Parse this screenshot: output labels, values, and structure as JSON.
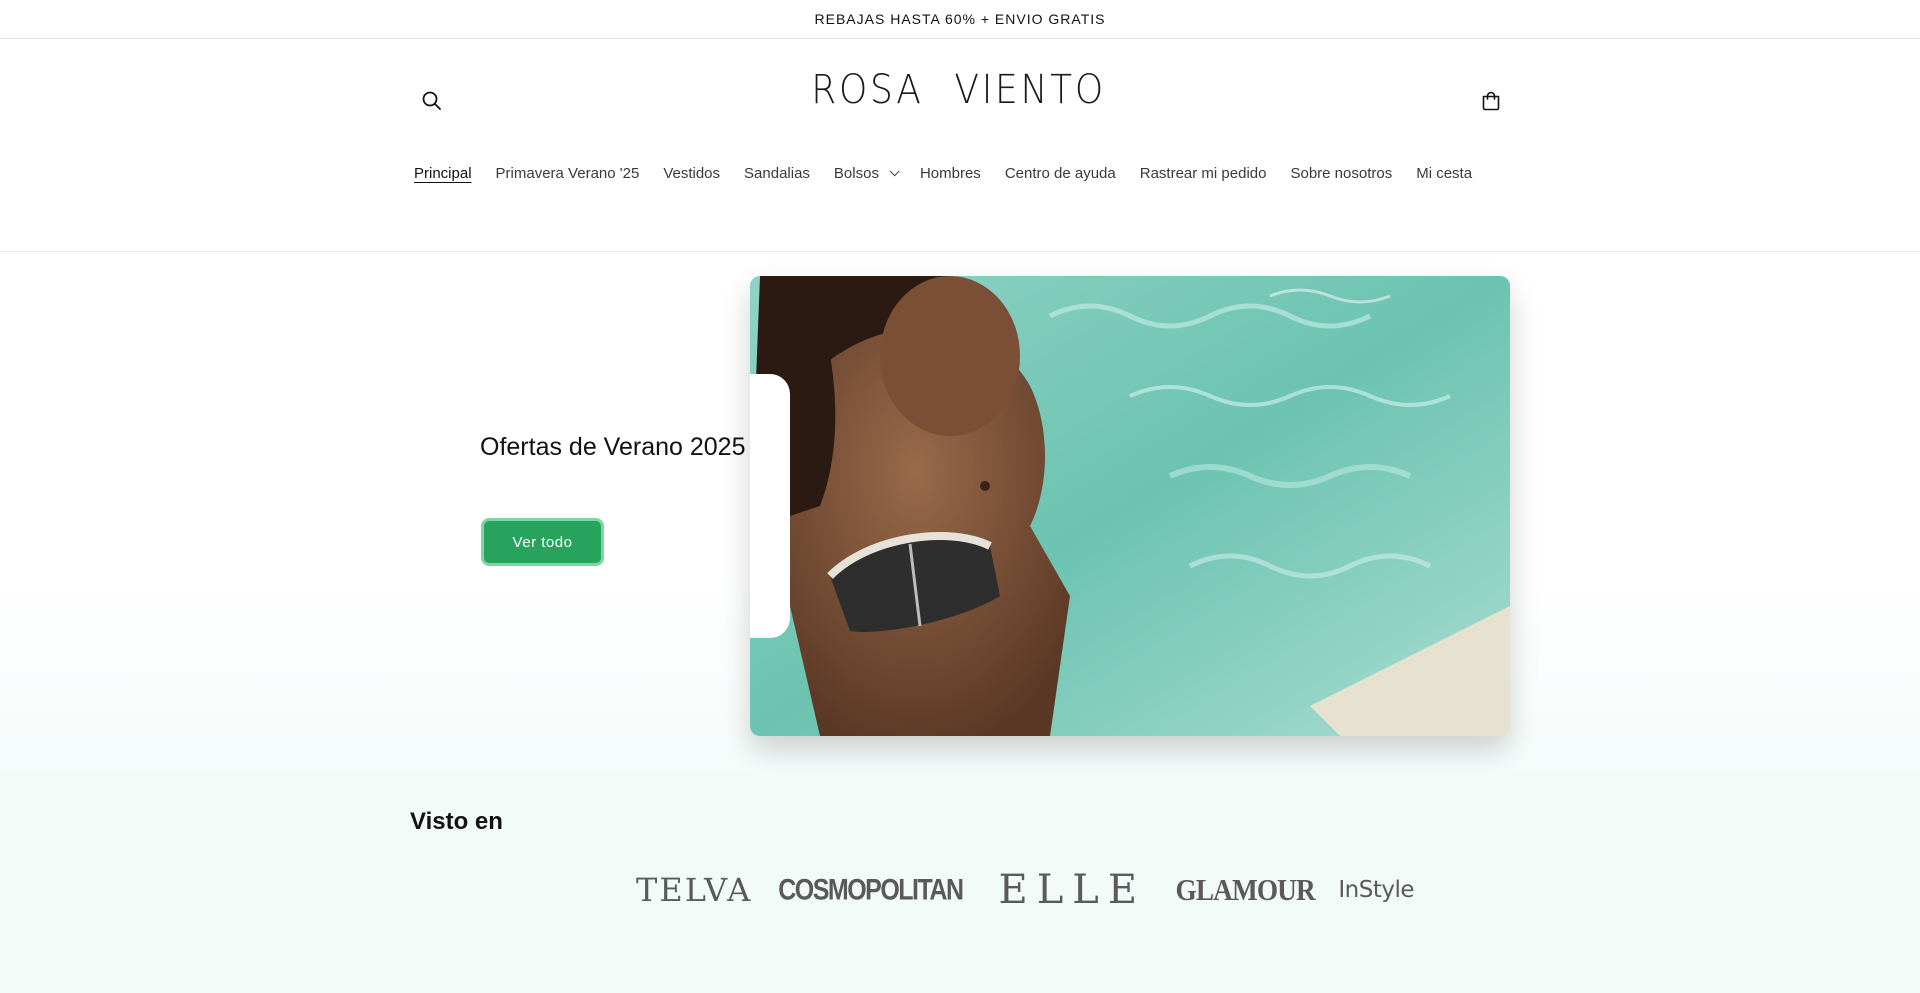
{
  "announcement": {
    "text": "REBAJAS HASTA 60% + ENVIO GRATIS"
  },
  "header": {
    "logo": {
      "left": "ROSA",
      "right": "VIENTO"
    },
    "search_icon": "search-icon",
    "cart_icon": "cart-icon"
  },
  "nav": {
    "items": [
      {
        "label": "Principal",
        "active": true
      },
      {
        "label": "Primavera Verano '25"
      },
      {
        "label": "Vestidos"
      },
      {
        "label": "Sandalias"
      },
      {
        "label": "Bolsos",
        "has_dropdown": true
      },
      {
        "label": "Hombres"
      },
      {
        "label": "Centro de ayuda"
      },
      {
        "label": "Rastrear mi pedido"
      },
      {
        "label": "Sobre nosotros"
      },
      {
        "label": "Mi cesta"
      }
    ]
  },
  "hero": {
    "title": "Ofertas de Verano 2025",
    "button_label": "Ver todo",
    "button_color": "#27a35e"
  },
  "seen_in": {
    "title": "Visto en",
    "publications": [
      "TELVA",
      "COSMOPOLITAN",
      "ELLE",
      "GLAMOUR",
      "InStyle"
    ]
  }
}
